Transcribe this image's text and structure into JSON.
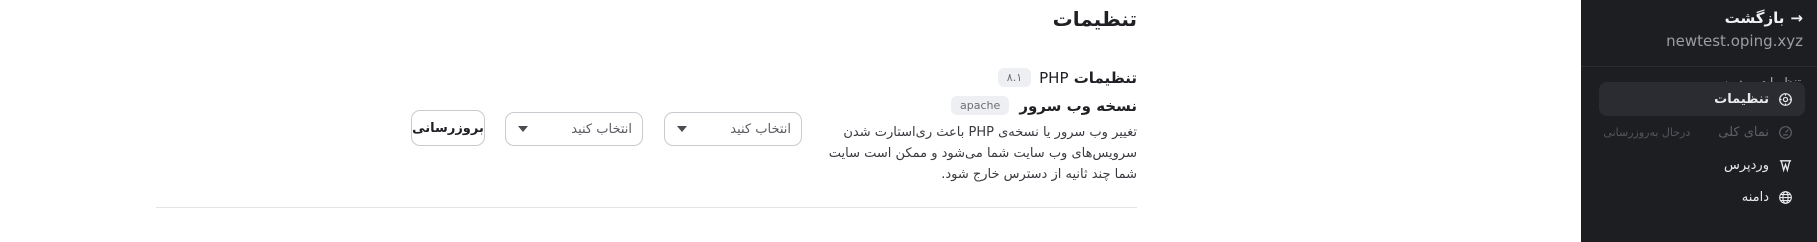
{
  "sidebar": {
    "back_label": "بازگشت",
    "back_icon": "arrow-right-icon",
    "domain": "newtest.oping.xyz",
    "section_title": "تنظیمات وردپرس",
    "items": [
      {
        "label": "تنظیمات",
        "icon": "settings-gear-icon",
        "active": true
      },
      {
        "label": "نمای کلی",
        "icon": "overview-icon",
        "disabled": true,
        "sub": "درحال به‌روزرسانی"
      },
      {
        "label": "وردپرس",
        "icon": "wordpress-icon"
      },
      {
        "label": "دامنه",
        "icon": "globe-icon"
      }
    ]
  },
  "main": {
    "title": "تنظیمات",
    "php": {
      "label_fa": "تنظیمات",
      "label_en": "PHP",
      "version_badge": "۸.۱"
    },
    "webserver": {
      "label": "نسخه وب سرور",
      "badge": "apache",
      "description": "تغییر وب سرور یا نسخه‌ی PHP باعث ری‌استارت شدن سرویس‌های وب سایت شما می‌شود و ممکن است سایت شما چند ثانیه از دسترس خارج شود."
    },
    "select_webserver": {
      "placeholder": "انتخاب کنید"
    },
    "select_php": {
      "placeholder": "انتخاب کنید"
    },
    "update_button": "بروزرسانی"
  }
}
